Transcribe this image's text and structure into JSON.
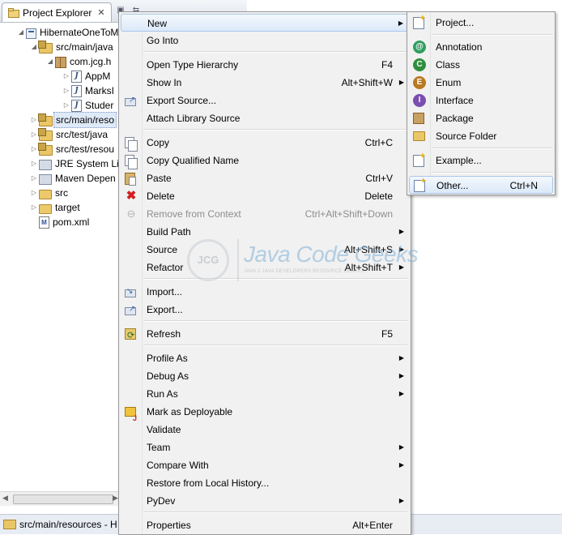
{
  "explorer": {
    "tab_title": "Project Explorer",
    "tree": [
      {
        "label": "HibernateOneToM"
      },
      {
        "label": "src/main/java"
      },
      {
        "label": "com.jcg.h"
      },
      {
        "label": "AppM"
      },
      {
        "label": "MarksI"
      },
      {
        "label": "Studer"
      },
      {
        "label": "src/main/reso"
      },
      {
        "label": "src/test/java"
      },
      {
        "label": "src/test/resou"
      },
      {
        "label": "JRE System Li"
      },
      {
        "label": "Maven Depen"
      },
      {
        "label": "src"
      },
      {
        "label": "target"
      },
      {
        "label": "pom.xml"
      }
    ]
  },
  "status_bar": {
    "text": "src/main/resources - H"
  },
  "context_menu": {
    "items": [
      {
        "label": "New",
        "shortcut": ""
      },
      {
        "label": "Go Into",
        "shortcut": ""
      },
      {
        "label": "Open Type Hierarchy",
        "shortcut": "F4"
      },
      {
        "label": "Show In",
        "shortcut": "Alt+Shift+W"
      },
      {
        "label": "Export Source...",
        "shortcut": ""
      },
      {
        "label": "Attach Library Source",
        "shortcut": ""
      },
      {
        "label": "Copy",
        "shortcut": "Ctrl+C"
      },
      {
        "label": "Copy Qualified Name",
        "shortcut": ""
      },
      {
        "label": "Paste",
        "shortcut": "Ctrl+V"
      },
      {
        "label": "Delete",
        "shortcut": "Delete"
      },
      {
        "label": "Remove from Context",
        "shortcut": "Ctrl+Alt+Shift+Down"
      },
      {
        "label": "Build Path",
        "shortcut": ""
      },
      {
        "label": "Source",
        "shortcut": "Alt+Shift+S"
      },
      {
        "label": "Refactor",
        "shortcut": "Alt+Shift+T"
      },
      {
        "label": "Import...",
        "shortcut": ""
      },
      {
        "label": "Export...",
        "shortcut": ""
      },
      {
        "label": "Refresh",
        "shortcut": "F5"
      },
      {
        "label": "Profile As",
        "shortcut": ""
      },
      {
        "label": "Debug As",
        "shortcut": ""
      },
      {
        "label": "Run As",
        "shortcut": ""
      },
      {
        "label": "Mark as Deployable",
        "shortcut": ""
      },
      {
        "label": "Validate",
        "shortcut": ""
      },
      {
        "label": "Team",
        "shortcut": ""
      },
      {
        "label": "Compare With",
        "shortcut": ""
      },
      {
        "label": "Restore from Local History...",
        "shortcut": ""
      },
      {
        "label": "PyDev",
        "shortcut": ""
      },
      {
        "label": "Properties",
        "shortcut": "Alt+Enter"
      }
    ]
  },
  "submenu": {
    "items": [
      {
        "label": "Project...",
        "shortcut": ""
      },
      {
        "label": "Annotation",
        "shortcut": ""
      },
      {
        "label": "Class",
        "shortcut": ""
      },
      {
        "label": "Enum",
        "shortcut": ""
      },
      {
        "label": "Interface",
        "shortcut": ""
      },
      {
        "label": "Package",
        "shortcut": ""
      },
      {
        "label": "Source Folder",
        "shortcut": ""
      },
      {
        "label": "Example...",
        "shortcut": ""
      },
      {
        "label": "Other...",
        "shortcut": "Ctrl+N"
      }
    ]
  },
  "watermark": {
    "badge": "JCG",
    "title": "Java Code Geeks",
    "subtitle": "JAVA 2 JAVA DEVELOPERS RESOURCE CENTER"
  }
}
